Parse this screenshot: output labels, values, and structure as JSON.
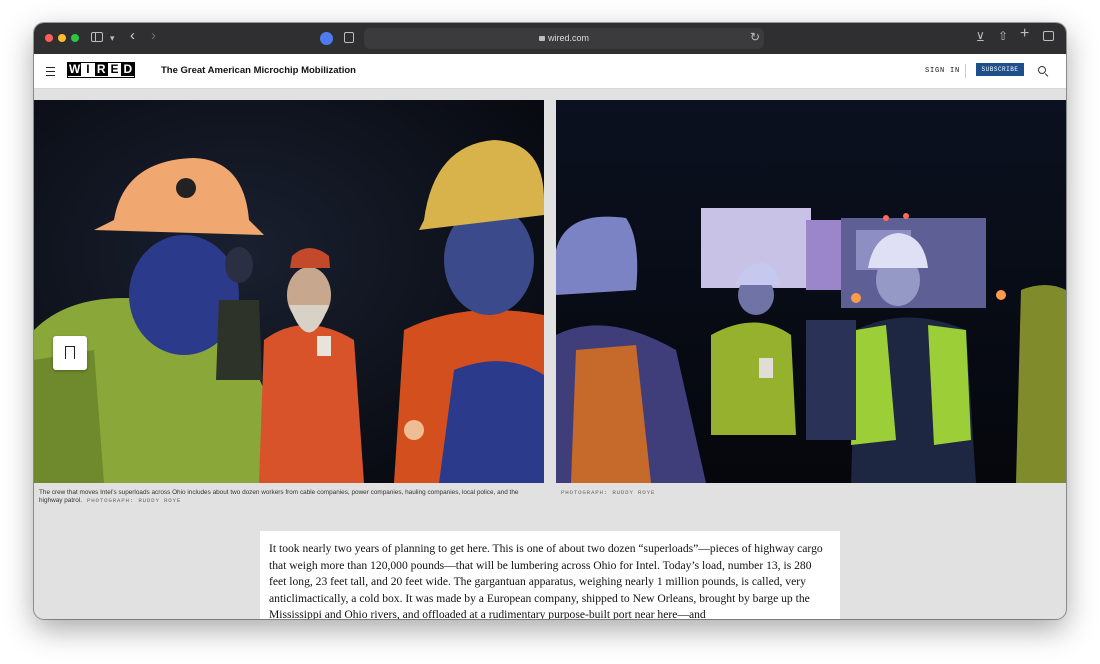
{
  "browser": {
    "url": "wired.com"
  },
  "site": {
    "logo_letters": [
      "W",
      "I",
      "R",
      "E",
      "D"
    ],
    "article_title": "The Great American Microchip Mobilization",
    "signin_label": "SIGN IN",
    "subscribe_label": "SUBSCRIBE"
  },
  "photos": {
    "left_caption": "The crew that moves Intel’s superloads across Ohio includes about two dozen workers from cable companies, power companies, hauling companies, local police, and the highway patrol.",
    "left_credit": "PHOTOGRAPH: RUDDY ROYE",
    "right_credit": "PHOTOGRAPH: RUDDY ROYE"
  },
  "article": {
    "paragraph": "It took nearly two years of planning to get here. This is one of about two dozen “superloads”—pieces of highway cargo that weigh more than 120,000 pounds—that will be lumbering across Ohio for Intel. Today’s load, number 13, is 280 feet long, 23 feet tall, and 20 feet wide. The gargantuan apparatus, weighing nearly 1 million pounds, is called, very anticlimactically, a cold box. It was made by a European company, shipped to New Orleans, brought by barge up the Mississippi and Ohio rivers, and offloaded at a rudimentary purpose-built port near here—and"
  }
}
